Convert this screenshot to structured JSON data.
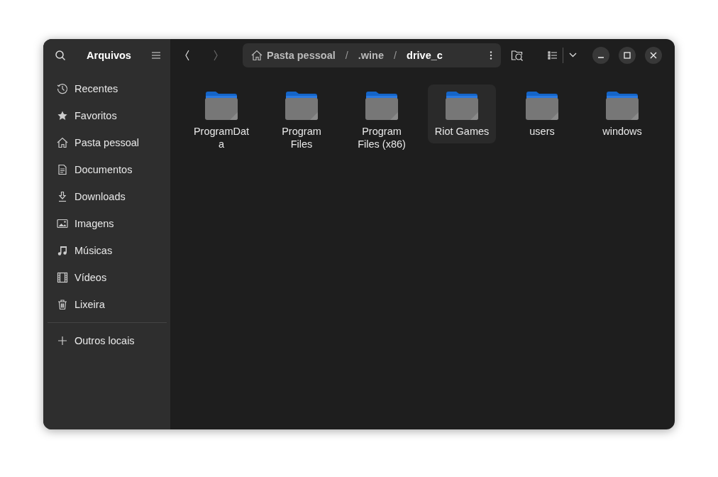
{
  "sidebar": {
    "title": "Arquivos",
    "items": [
      {
        "kind": "recent",
        "label": "Recentes"
      },
      {
        "kind": "starred",
        "label": "Favoritos"
      },
      {
        "kind": "home",
        "label": "Pasta pessoal"
      },
      {
        "kind": "documents",
        "label": "Documentos"
      },
      {
        "kind": "downloads",
        "label": "Downloads"
      },
      {
        "kind": "pictures",
        "label": "Imagens"
      },
      {
        "kind": "music",
        "label": "Músicas"
      },
      {
        "kind": "videos",
        "label": "Vídeos"
      },
      {
        "kind": "trash",
        "label": "Lixeira"
      }
    ],
    "other_locations": "Outros locais"
  },
  "path": [
    {
      "label": "Pasta pessoal",
      "kind": "home",
      "selected": false
    },
    {
      "separator": "/",
      "label": ".wine",
      "selected": false
    },
    {
      "separator": "/",
      "label": "drive_c",
      "selected": true
    }
  ],
  "folders": [
    {
      "name": "ProgramData",
      "selected": false
    },
    {
      "name": "Program Files",
      "selected": false
    },
    {
      "name": "Program Files (x86)",
      "selected": false
    },
    {
      "name": "Riot Games",
      "selected": true
    },
    {
      "name": "users",
      "selected": false
    },
    {
      "name": "windows",
      "selected": false
    }
  ]
}
